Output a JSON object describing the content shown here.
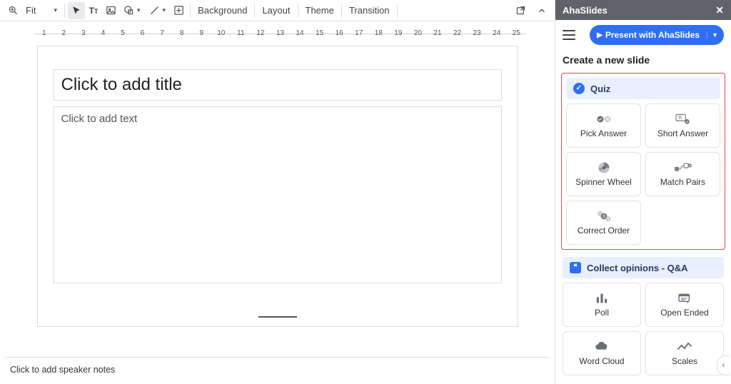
{
  "toolbar": {
    "zoom_label": "Fit",
    "background": "Background",
    "layout": "Layout",
    "theme": "Theme",
    "transition": "Transition"
  },
  "ruler": {
    "ticks": [
      1,
      2,
      3,
      4,
      5,
      6,
      7,
      8,
      9,
      10,
      11,
      12,
      13,
      14,
      15,
      16,
      17,
      18,
      19,
      20,
      21,
      22,
      23,
      24,
      25
    ]
  },
  "slide": {
    "title_placeholder": "Click to add title",
    "body_placeholder": "Click to add text"
  },
  "notes_placeholder": "Click to add speaker notes",
  "sidebar": {
    "title": "AhaSlides",
    "present_label": "Present with AhaSlides",
    "create_heading": "Create a new slide",
    "quiz": {
      "title": "Quiz",
      "cards": [
        {
          "label": "Pick Answer",
          "icon": "pick-answer-icon"
        },
        {
          "label": "Short Answer",
          "icon": "short-answer-icon"
        },
        {
          "label": "Spinner Wheel",
          "icon": "spinner-wheel-icon"
        },
        {
          "label": "Match Pairs",
          "icon": "match-pairs-icon"
        },
        {
          "label": "Correct Order",
          "icon": "correct-order-icon"
        }
      ]
    },
    "opinions": {
      "title": "Collect opinions - Q&A",
      "cards": [
        {
          "label": "Poll",
          "icon": "poll-icon"
        },
        {
          "label": "Open Ended",
          "icon": "open-ended-icon"
        },
        {
          "label": "Word Cloud",
          "icon": "word-cloud-icon"
        },
        {
          "label": "Scales",
          "icon": "scales-icon"
        }
      ]
    }
  }
}
